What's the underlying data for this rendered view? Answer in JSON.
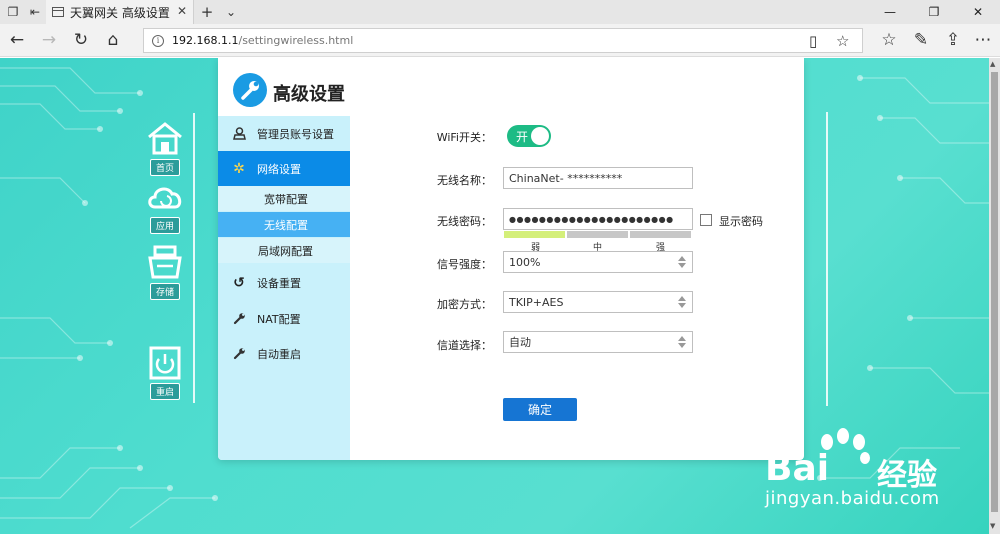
{
  "browser": {
    "tab_title": "天翼网关 高级设置",
    "url_host": "192.168.1.1",
    "url_path": "/settingwireless.html"
  },
  "brand": {
    "title": "高级设置",
    "accent": "#0b8be7",
    "toggle_on": "#1dbb85"
  },
  "rail": {
    "items": [
      {
        "label": "首页",
        "icon": "home-icon"
      },
      {
        "label": "应用",
        "icon": "cloud-icon"
      },
      {
        "label": "存储",
        "icon": "storage-icon"
      },
      {
        "label": "重启",
        "icon": "power-icon"
      }
    ]
  },
  "sidebar": {
    "items": [
      {
        "label": "管理员账号设置",
        "icon": "user-icon"
      },
      {
        "label": "网络设置",
        "icon": "gear-icon",
        "active": true
      },
      {
        "label": "设备重置",
        "icon": "reset-icon"
      },
      {
        "label": "NAT配置",
        "icon": "wrench-icon"
      },
      {
        "label": "自动重启",
        "icon": "wrench-icon"
      }
    ],
    "subitems": [
      {
        "label": "宽带配置"
      },
      {
        "label": "无线配置",
        "active": true
      },
      {
        "label": "局域网配置"
      }
    ]
  },
  "form": {
    "wifi_label": "WiFi开关：",
    "wifi_state": "开",
    "ssid_label": "无线名称：",
    "ssid_value": "ChinaNet- **********",
    "password_label": "无线密码：",
    "password_value": "●●●●●●●●●●●●●●●●●●●●●●",
    "show_password_label": "显示密码",
    "strength": {
      "weak": "弱",
      "medium": "中",
      "strong": "强",
      "level": "weak"
    },
    "signal_label": "信号强度：",
    "signal_value": "100%",
    "encryption_label": "加密方式：",
    "encryption_value": "TKIP+AES",
    "channel_label": "信道选择：",
    "channel_value": "自动",
    "confirm_label": "确定"
  },
  "watermark": {
    "brand": "Bai",
    "brand_cn": "经验",
    "url": "jingyan.baidu.com"
  }
}
